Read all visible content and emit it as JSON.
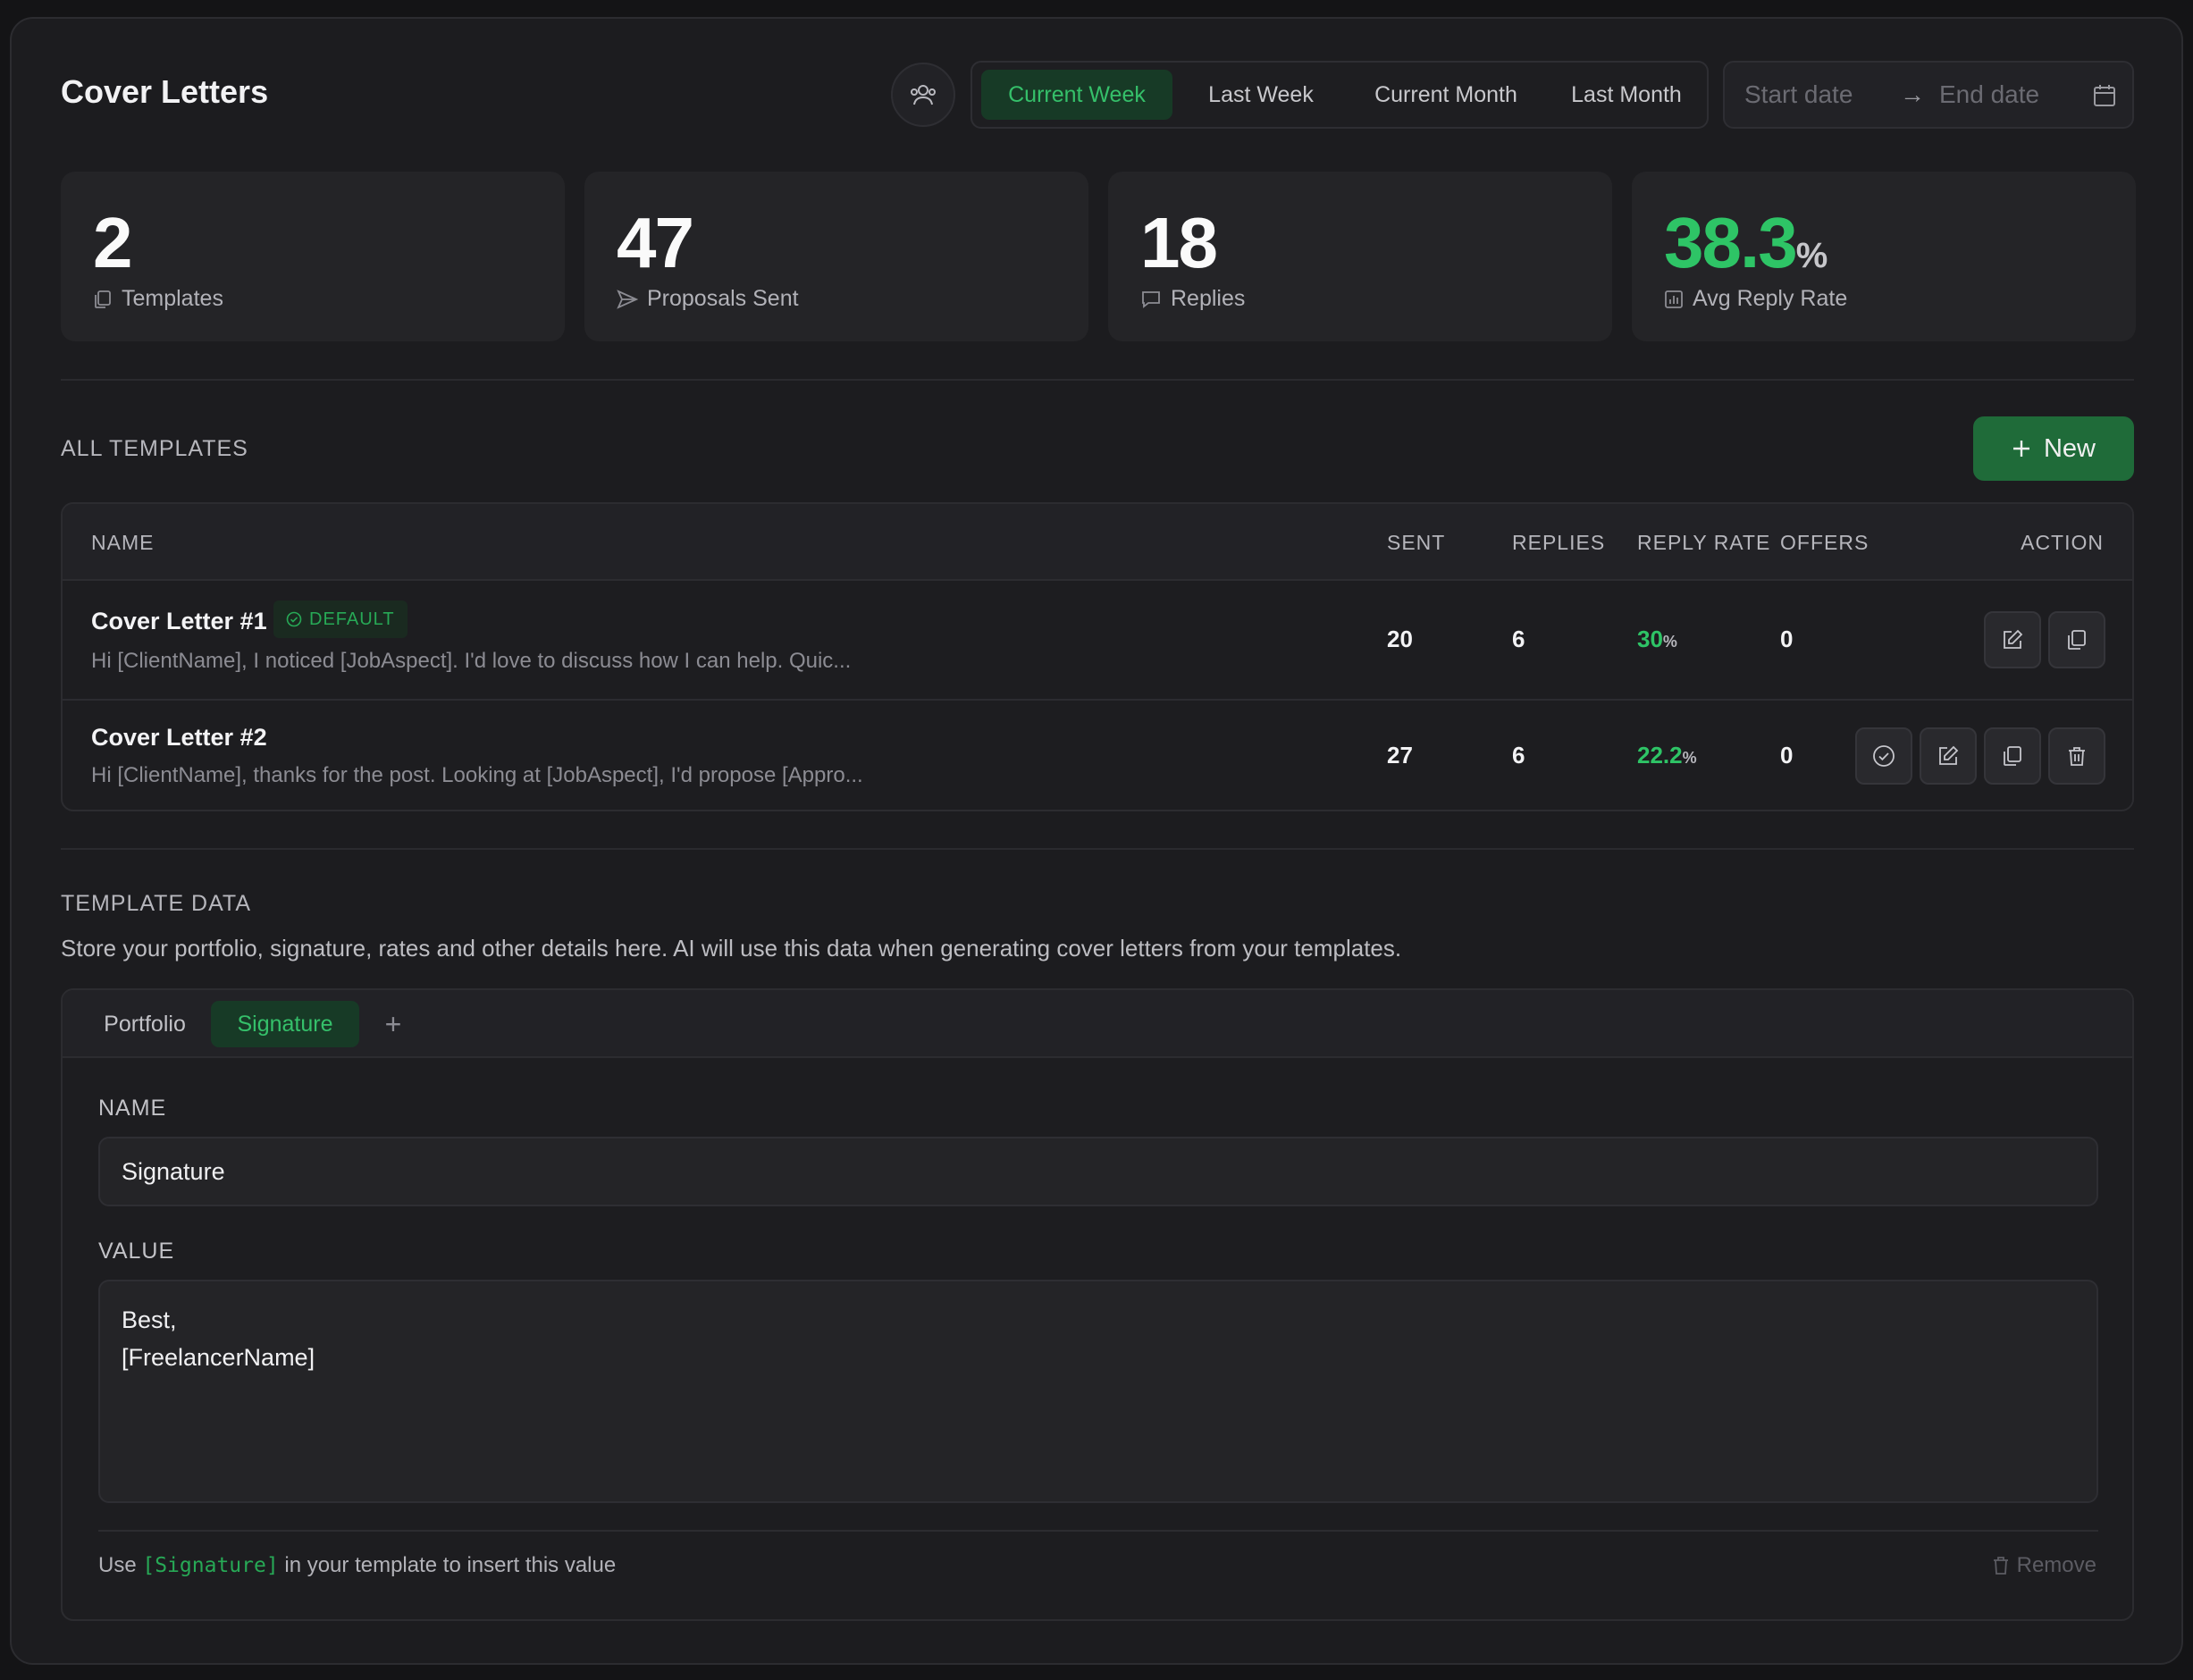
{
  "page": {
    "title": "Cover Letters"
  },
  "range_tabs": [
    {
      "label": "Current Week",
      "active": true
    },
    {
      "label": "Last Week"
    },
    {
      "label": "Current Month"
    },
    {
      "label": "Last Month"
    }
  ],
  "date_range": {
    "start_placeholder": "Start date",
    "end_placeholder": "End date",
    "arrow": "→"
  },
  "stats": [
    {
      "value": "2",
      "label": "Templates",
      "icon": "copy-icon"
    },
    {
      "value": "47",
      "label": "Proposals Sent",
      "icon": "send-icon"
    },
    {
      "value": "18",
      "label": "Replies",
      "icon": "chat-icon"
    },
    {
      "value": "38.3",
      "unit": "%",
      "label": "Avg Reply Rate",
      "icon": "bar-chart-icon"
    }
  ],
  "templates_section": {
    "heading": "ALL TEMPLATES",
    "new_button": "New",
    "columns": [
      "NAME",
      "SENT",
      "REPLIES",
      "REPLY RATE",
      "OFFERS",
      "ACTION"
    ],
    "rows": [
      {
        "name": "Cover Letter #1",
        "badge": "DEFAULT",
        "preview": "Hi [ClientName], I noticed [JobAspect]. I'd love to discuss how I can help. Quic...",
        "sent": "20",
        "replies": "6",
        "reply_rate": "30",
        "reply_rate_unit": "%",
        "offers": "0"
      },
      {
        "name": "Cover Letter #2",
        "preview": "Hi [ClientName], thanks for the post. Looking at [JobAspect], I'd propose [Appro...",
        "sent": "27",
        "replies": "6",
        "reply_rate": "22.2",
        "reply_rate_unit": "%",
        "offers": "0"
      }
    ]
  },
  "template_data": {
    "heading": "TEMPLATE DATA",
    "description": "Store your portfolio, signature, rates and other details here. AI will use this data when generating cover letters from your templates.",
    "tabs": [
      {
        "label": "Portfolio"
      },
      {
        "label": "Signature",
        "active": true
      }
    ],
    "add_tab": "+",
    "name_label": "NAME",
    "name_value": "Signature",
    "value_label": "VALUE",
    "value_text": "Best,\n[FreelancerName]",
    "hint_prefix": "Use",
    "hint_code": "[Signature]",
    "hint_suffix": "in your template to insert this value",
    "remove_label": "Remove"
  },
  "colors": {
    "accent_green": "#2ec466",
    "new_button": "#1f6b39",
    "background": "#1c1c1f"
  }
}
